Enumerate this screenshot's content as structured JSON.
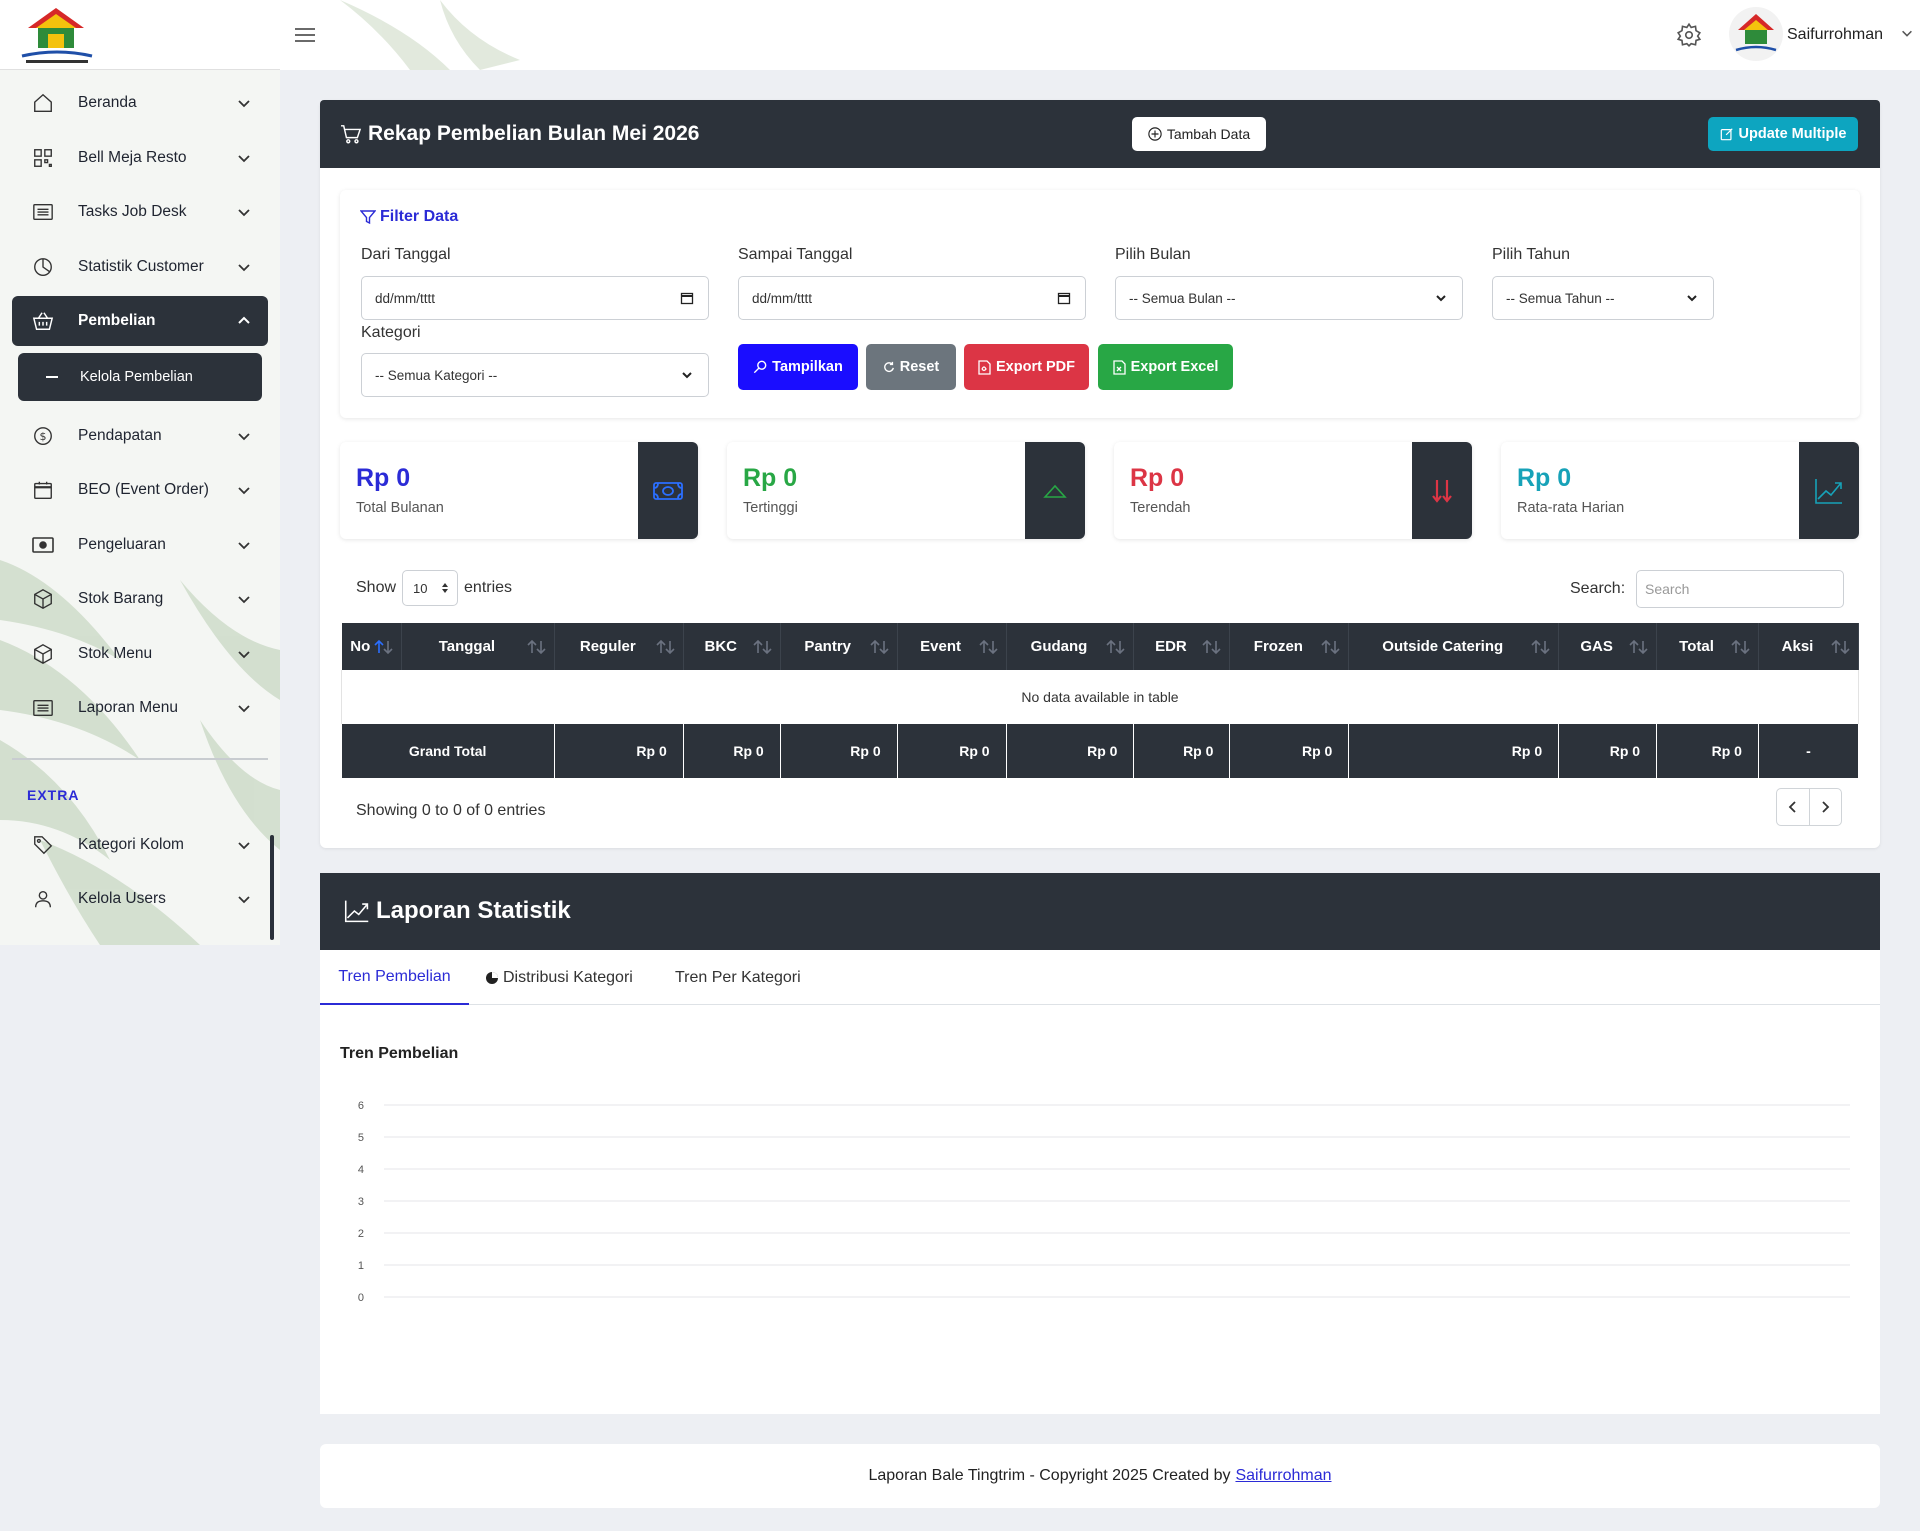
{
  "user": {
    "name": "Saifurrohman"
  },
  "sidebar": {
    "items": [
      {
        "label": "Beranda",
        "icon": "home-icon"
      },
      {
        "label": "Bell Meja Resto",
        "icon": "qr-icon"
      },
      {
        "label": "Tasks Job Desk",
        "icon": "list-icon"
      },
      {
        "label": "Statistik Customer",
        "icon": "pie-icon"
      },
      {
        "label": "Pembelian",
        "icon": "basket-icon"
      },
      {
        "label": "Pendapatan",
        "icon": "dollar-icon"
      },
      {
        "label": "BEO (Event Order)",
        "icon": "calendar-icon"
      },
      {
        "label": "Pengeluaran",
        "icon": "cash-icon"
      },
      {
        "label": "Stok Barang",
        "icon": "box-icon"
      },
      {
        "label": "Stok Menu",
        "icon": "box-icon"
      },
      {
        "label": "Laporan Menu",
        "icon": "list-icon"
      }
    ],
    "submenu_active": "Kelola Pembelian",
    "extra_label": "EXTRA",
    "extra_items": [
      {
        "label": "Kategori Kolom",
        "icon": "tags-icon"
      },
      {
        "label": "Kelola Users",
        "icon": "user-icon"
      }
    ]
  },
  "rekap": {
    "title": "Rekap Pembelian Bulan Mei 2026",
    "tambah_label": "Tambah Data",
    "update_label": "Update Multiple"
  },
  "filter": {
    "title": "Filter Data",
    "dari_label": "Dari Tanggal",
    "dari_placeholder": "dd/mm/tttt",
    "sampai_label": "Sampai Tanggal",
    "sampai_placeholder": "dd/mm/tttt",
    "bulan_label": "Pilih Bulan",
    "bulan_value": "-- Semua Bulan --",
    "tahun_label": "Pilih Tahun",
    "tahun_value": "-- Semua Tahun --",
    "kategori_label": "Kategori",
    "kategori_value": "-- Semua Kategori --",
    "btn_tampilkan": "Tampilkan",
    "btn_reset": "Reset",
    "btn_pdf": "Export PDF",
    "btn_excel": "Export Excel"
  },
  "stats": [
    {
      "value": "Rp 0",
      "caption": "Total Bulanan",
      "color": "#2b2bd6"
    },
    {
      "value": "Rp 0",
      "caption": "Tertinggi",
      "color": "#28a745"
    },
    {
      "value": "Rp 0",
      "caption": "Terendah",
      "color": "#dc3545"
    },
    {
      "value": "Rp 0",
      "caption": "Rata-rata Harian",
      "color": "#17a2b8"
    }
  ],
  "table": {
    "show": "Show",
    "entries": "entries",
    "length_value": "10",
    "search_label": "Search:",
    "search_placeholder": "Search",
    "columns": [
      "No",
      "Tanggal",
      "Reguler",
      "BKC",
      "Pantry",
      "Event",
      "Gudang",
      "EDR",
      "Frozen",
      "Outside Catering",
      "GAS",
      "Total",
      "Aksi"
    ],
    "empty_message": "No data available in table",
    "grand_total_label": "Grand Total",
    "totals": [
      "Rp 0",
      "Rp 0",
      "Rp 0",
      "Rp 0",
      "Rp 0",
      "Rp 0",
      "Rp 0",
      "Rp 0",
      "Rp 0",
      "Rp 0"
    ],
    "aksi_total": "-",
    "info": "Showing 0 to 0 of 0 entries"
  },
  "statistik": {
    "title": "Laporan Statistik",
    "tabs": [
      "Tren Pembelian",
      "Distribusi Kategori",
      "Tren Per Kategori"
    ],
    "active_tab": 0
  },
  "chart_data": {
    "type": "line",
    "title": "Tren Pembelian",
    "xlabel": "",
    "ylabel": "",
    "ylim": [
      0,
      6
    ],
    "yticks": [
      "0",
      "1",
      "2",
      "3",
      "4",
      "5",
      "6"
    ],
    "series": [],
    "grid": true
  },
  "footer": {
    "text": "Laporan Bale Tingtrim - Copyright 2025 Created by",
    "link": "Saifurrohman"
  },
  "colors": {
    "dark": "#2c323a",
    "primary": "#2b2bd6",
    "secondary": "#6c757d",
    "danger": "#dc3545",
    "success": "#28a745",
    "info": "#0da5c0"
  }
}
